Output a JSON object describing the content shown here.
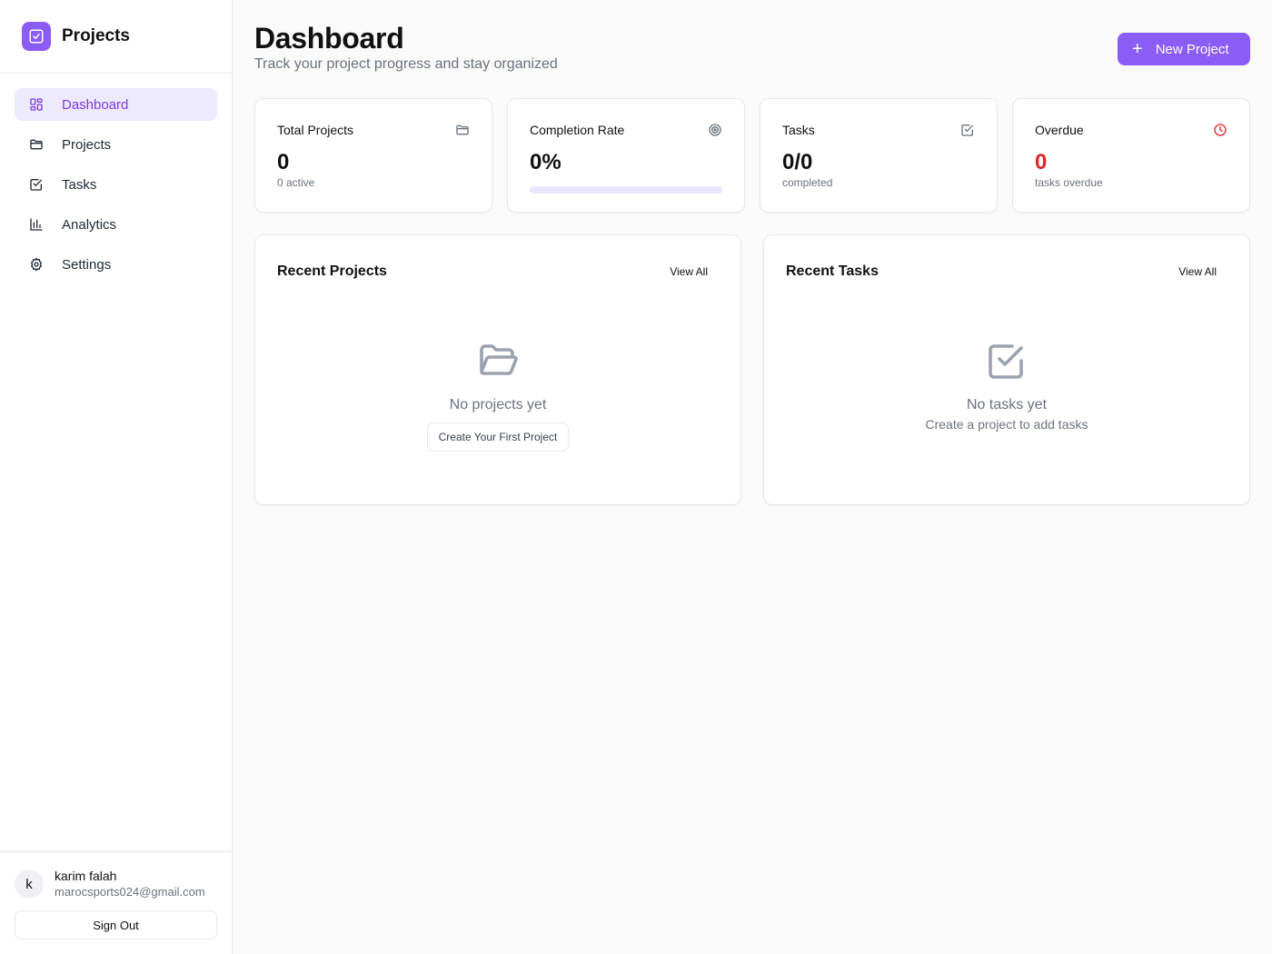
{
  "app": {
    "name": "Projects",
    "accent": "#8b5cf6"
  },
  "sidebar": {
    "items": [
      {
        "label": "Dashboard",
        "icon": "grid-icon",
        "active": true
      },
      {
        "label": "Projects",
        "icon": "folder-icon"
      },
      {
        "label": "Tasks",
        "icon": "check-square-icon"
      },
      {
        "label": "Analytics",
        "icon": "bar-chart-icon"
      },
      {
        "label": "Settings",
        "icon": "gear-icon"
      }
    ]
  },
  "user": {
    "initial": "k",
    "name": "karim falah",
    "email": "marocsports024@gmail.com",
    "signout_label": "Sign Out"
  },
  "header": {
    "title": "Dashboard",
    "subtitle": "Track your project progress and stay organized",
    "new_project_icon": "plus-icon",
    "new_project_label": "New Project"
  },
  "stats": {
    "total_projects": {
      "title": "Total Projects",
      "value": "0",
      "sub": "0 active",
      "icon": "folder-icon"
    },
    "completion_rate": {
      "title": "Completion Rate",
      "value": "0%",
      "progress": 0,
      "icon": "target-icon"
    },
    "tasks": {
      "title": "Tasks",
      "value": "0/0",
      "sub": "completed",
      "icon": "check-square-icon"
    },
    "overdue": {
      "title": "Overdue",
      "value": "0",
      "sub": "tasks overdue",
      "icon": "clock-icon",
      "color": "#dc2626"
    }
  },
  "recent_projects": {
    "title": "Recent Projects",
    "view_all": "View All",
    "empty_text": "No projects yet",
    "cta_label": "Create Your First Project",
    "empty_icon": "folder-open-icon"
  },
  "recent_tasks": {
    "title": "Recent Tasks",
    "view_all": "View All",
    "empty_text": "No tasks yet",
    "empty_sub": "Create a project to add tasks",
    "empty_icon": "check-square-icon"
  }
}
